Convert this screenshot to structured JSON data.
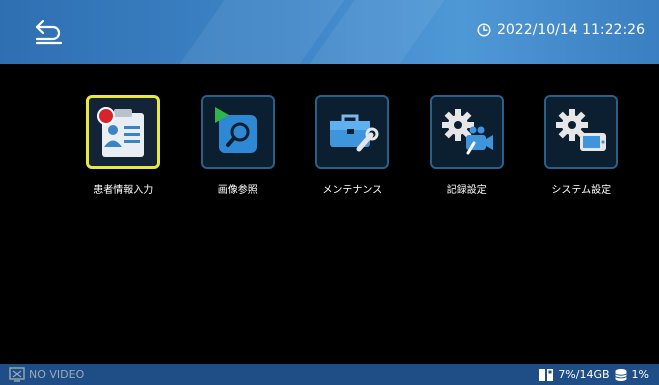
{
  "header": {
    "back_icon": "return-arrow-icon",
    "clock_icon": "clock-icon",
    "datetime": "2022/10/14 11:22:26"
  },
  "menu": {
    "items": [
      {
        "label": "患者情報入力",
        "icon": "patient-info-icon",
        "selected": true
      },
      {
        "label": "画像参照",
        "icon": "image-search-icon",
        "selected": false
      },
      {
        "label": "メンテナンス",
        "icon": "toolbox-icon",
        "selected": false
      },
      {
        "label": "記録設定",
        "icon": "recording-settings-icon",
        "selected": false
      },
      {
        "label": "システム設定",
        "icon": "system-settings-icon",
        "selected": false
      }
    ]
  },
  "statusbar": {
    "video_icon": "video-input-icon",
    "video_status": "NO VIDEO",
    "storage_icon": "storage-icon",
    "storage_usage": "7%/14GB",
    "disk_icon": "database-icon",
    "disk_usage": "1%"
  },
  "colors": {
    "header": "#3f86c8",
    "statusbar": "#1f4e86",
    "selected_border": "#e8e845",
    "tile_border": "#2a5f88"
  }
}
